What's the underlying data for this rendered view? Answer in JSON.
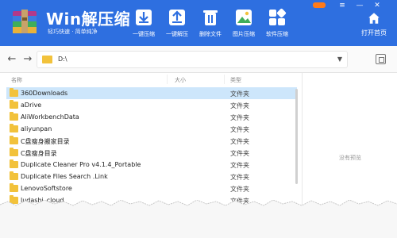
{
  "header": {
    "app_title": "Win解压缩",
    "slogan": "轻巧快速 · 简单纯净",
    "tools": [
      {
        "label": "一键压缩",
        "icon": "compress-icon"
      },
      {
        "label": "一键解压",
        "icon": "extract-icon"
      },
      {
        "label": "删除文件",
        "icon": "trash-icon"
      },
      {
        "label": "图片压缩",
        "icon": "image-compress-icon"
      },
      {
        "label": "软件压缩",
        "icon": "apps-icon"
      }
    ],
    "open_home_label": "打开首页",
    "window_controls": [
      "≡",
      "—",
      "✕"
    ]
  },
  "addressbar": {
    "back_icon": "←",
    "forward_icon": "→",
    "path": "D:\\",
    "caret": "▼"
  },
  "filelist": {
    "columns": {
      "name": "名称",
      "size": "大小",
      "type": "类型"
    },
    "rows": [
      {
        "name": "360Downloads",
        "type": "文件夹",
        "selected": true
      },
      {
        "name": "aDrive",
        "type": "文件夹"
      },
      {
        "name": "AliWorkbenchData",
        "type": "文件夹"
      },
      {
        "name": "aliyunpan",
        "type": "文件夹"
      },
      {
        "name": "C盘瘦身搬家目录",
        "type": "文件夹"
      },
      {
        "name": "C盘瘦身目录",
        "type": "文件夹"
      },
      {
        "name": "Duplicate Cleaner Pro v4.1.4_Portable",
        "type": "文件夹"
      },
      {
        "name": "Duplicate Files Search .Link",
        "type": "文件夹"
      },
      {
        "name": "LenovoSoftstore",
        "type": "文件夹"
      },
      {
        "name": "ludashi_cloud",
        "type": "文件夹"
      }
    ]
  },
  "preview": {
    "empty_text": "没有预览"
  }
}
